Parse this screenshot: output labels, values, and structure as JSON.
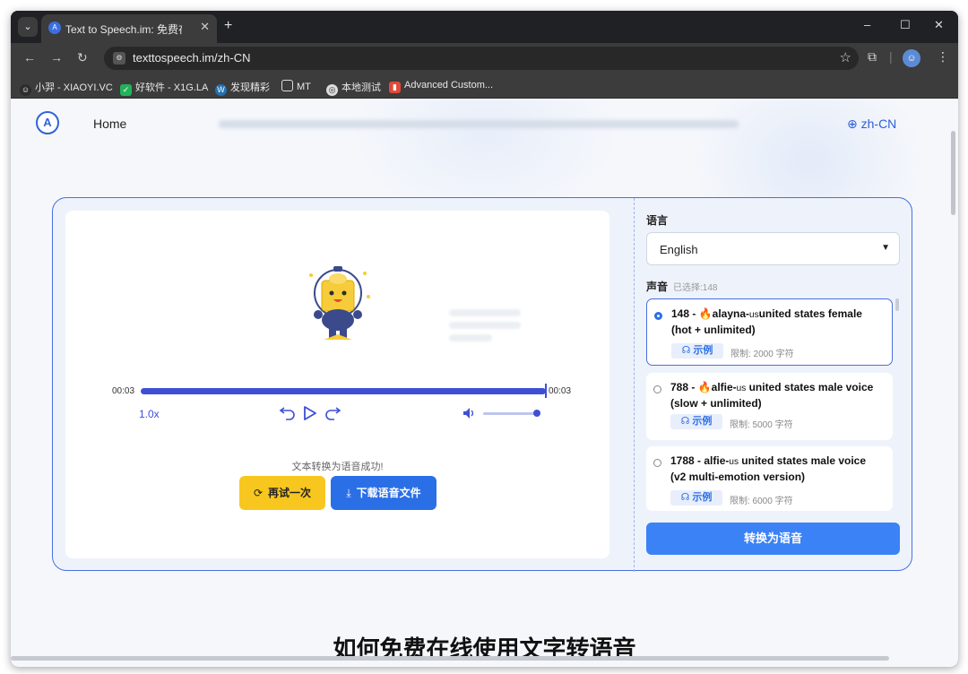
{
  "browser": {
    "tab_title": "Text to Speech.im: 免费在",
    "tab_favicon": "A",
    "url": "texttospeech.im/zh-CN",
    "bookmarks": [
      {
        "label": "小羿 - XIAOYI.VC",
        "icon": "smile-icon",
        "color": "#2d2d2d"
      },
      {
        "label": "好软件 - X1G.LA",
        "icon": "green-square-icon",
        "color": "#22b35a"
      },
      {
        "label": "发现精彩",
        "icon": "wordpress-icon",
        "color": "#2271b1"
      },
      {
        "label": "MT",
        "icon": "folder-icon",
        "color": "#3c3c3c"
      },
      {
        "label": "本地测试",
        "icon": "globe-icon",
        "color": "#3c3c3c"
      },
      {
        "label": "Advanced Custom...",
        "icon": "bookmark-icon",
        "color": "#e2493a"
      }
    ]
  },
  "site": {
    "logo": "A",
    "nav_home": "Home",
    "lang_link": "zh-CN"
  },
  "player": {
    "time_current": "00:03",
    "time_total": "00:03",
    "speed": "1.0x",
    "progress": 1.0,
    "volume": 1.0,
    "success_message": "文本转换为语音成功!",
    "retry_label": "再试一次",
    "download_label": "下载语音文件"
  },
  "settings": {
    "language_label": "语言",
    "language_value": "English",
    "voice_label": "声音",
    "voice_selected": "已选择:148",
    "voices": [
      {
        "id": "148 -",
        "name": "alayna-",
        "region": "us",
        "rest": "united states female",
        "note": "(hot + unlimited)",
        "sample": "示例",
        "limit": "限制: 2000 字符",
        "selected": true
      },
      {
        "id": "788 -",
        "name": "alfie-",
        "region": "us",
        "rest": " united states male voice",
        "note": "(slow + unlimited)",
        "sample": "示例",
        "limit": "限制: 5000 字符",
        "selected": false
      },
      {
        "id": "1788 -",
        "name": "alfie-",
        "region": "us",
        "rest": " united states male voice",
        "note": "(v2 multi-emotion version)",
        "sample": "示例",
        "limit": "限制: 6000 字符",
        "selected": false
      }
    ],
    "convert_label": "转换为语音"
  },
  "section_heading_peek": "如何免费在线使用文字转语音",
  "colors": {
    "accent": "#3e4fd6",
    "primary_button": "#2b6fe6",
    "convert_button": "#3b82f6",
    "retry_button": "#f8c71f",
    "border": "#4a6fe0"
  }
}
